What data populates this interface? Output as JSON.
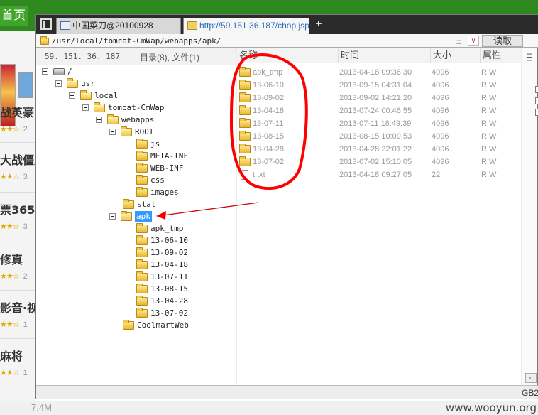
{
  "background": {
    "home_label": "首页",
    "titles": [
      "战英豪",
      "大战僵尸",
      "票365",
      "修真",
      "影音·视",
      "麻将"
    ],
    "star_counts": [
      "2",
      "3",
      "3",
      "2",
      "1",
      "1"
    ],
    "size_label": "7.4M"
  },
  "window": {
    "tabs": [
      {
        "label": "中国菜刀@20100928"
      },
      {
        "label": "http://59.151.36.187/chop.jsp"
      }
    ],
    "new_tab_symbol": "+",
    "address": {
      "path": "/usr/local/tomcat-CmWap/webapps/apk/",
      "plus_minus": "±",
      "dropdown_symbol": "∨",
      "read_button": "读取"
    },
    "info": {
      "server_ip": "59. 151. 36. 187",
      "dir_count": "目录(8), 文件(1)"
    },
    "tree": [
      {
        "label": "/",
        "icon": "drive-icon",
        "expander": true
      },
      {
        "label": "usr",
        "icon": "folder-icon",
        "expander": true
      },
      {
        "label": "local",
        "icon": "folder-icon",
        "expander": true
      },
      {
        "label": "tomcat-CmWap",
        "icon": "folder-icon",
        "expander": true
      },
      {
        "label": "webapps",
        "icon": "folder-icon",
        "expander": true
      },
      {
        "label": "ROOT",
        "icon": "folder-icon",
        "expander": true
      },
      {
        "label": "js",
        "icon": "folder-icon",
        "expander": false
      },
      {
        "label": "META-INF",
        "icon": "folder-icon",
        "expander": false
      },
      {
        "label": "WEB-INF",
        "icon": "folder-icon",
        "expander": false
      },
      {
        "label": "css",
        "icon": "folder-icon",
        "expander": false
      },
      {
        "label": "images",
        "icon": "folder-icon",
        "expander": false
      },
      {
        "label": "stat",
        "icon": "folder-icon",
        "expander": false
      },
      {
        "label": "apk",
        "icon": "folder-icon",
        "expander": true,
        "selected": true
      },
      {
        "label": "apk_tmp",
        "icon": "folder-icon",
        "expander": false
      },
      {
        "label": "13-06-10",
        "icon": "folder-icon",
        "expander": false
      },
      {
        "label": "13-09-02",
        "icon": "folder-icon",
        "expander": false
      },
      {
        "label": "13-04-18",
        "icon": "folder-icon",
        "expander": false
      },
      {
        "label": "13-07-11",
        "icon": "folder-icon",
        "expander": false
      },
      {
        "label": "13-08-15",
        "icon": "folder-icon",
        "expander": false
      },
      {
        "label": "13-04-28",
        "icon": "folder-icon",
        "expander": false
      },
      {
        "label": "13-07-02",
        "icon": "folder-icon",
        "expander": false
      },
      {
        "label": "CoolmartWeb",
        "icon": "folder-icon",
        "expander": false
      }
    ],
    "columns": {
      "name": "名称",
      "time": "时间",
      "size": "大小",
      "attr": "属性"
    },
    "files": [
      {
        "name": "apk_tmp",
        "time": "2013-04-18 09:36:30",
        "size": "4096",
        "attr": "R W",
        "icon": "folder-icon"
      },
      {
        "name": "13-06-10",
        "time": "2013-09-15 04:31:04",
        "size": "4096",
        "attr": "R W",
        "icon": "folder-icon"
      },
      {
        "name": "13-09-02",
        "time": "2013-09-02 14:21:20",
        "size": "4096",
        "attr": "R W",
        "icon": "folder-icon"
      },
      {
        "name": "13-04-18",
        "time": "2013-07-24 00:46:55",
        "size": "4096",
        "attr": "R W",
        "icon": "folder-icon"
      },
      {
        "name": "13-07-11",
        "time": "2013-07-11 18:49:39",
        "size": "4096",
        "attr": "R W",
        "icon": "folder-icon"
      },
      {
        "name": "13-08-15",
        "time": "2013-08-15 10:09:53",
        "size": "4096",
        "attr": "R W",
        "icon": "folder-icon"
      },
      {
        "name": "13-04-28",
        "time": "2013-04-28 22:01:22",
        "size": "4096",
        "attr": "R W",
        "icon": "folder-icon"
      },
      {
        "name": "13-07-02",
        "time": "2013-07-02 15:10:05",
        "size": "4096",
        "attr": "R W",
        "icon": "folder-icon"
      },
      {
        "name": "t.txt",
        "time": "2013-04-18 09:27:05",
        "size": "22",
        "attr": "R W",
        "icon": "file-icon"
      }
    ],
    "right_panel": {
      "label": "日"
    },
    "encoding": "GB2"
  },
  "watermark": "www.wooyun.org",
  "colors": {
    "annotation": "#ff0000",
    "selected": "#3399ff",
    "topbar": "#2e8a1f"
  }
}
